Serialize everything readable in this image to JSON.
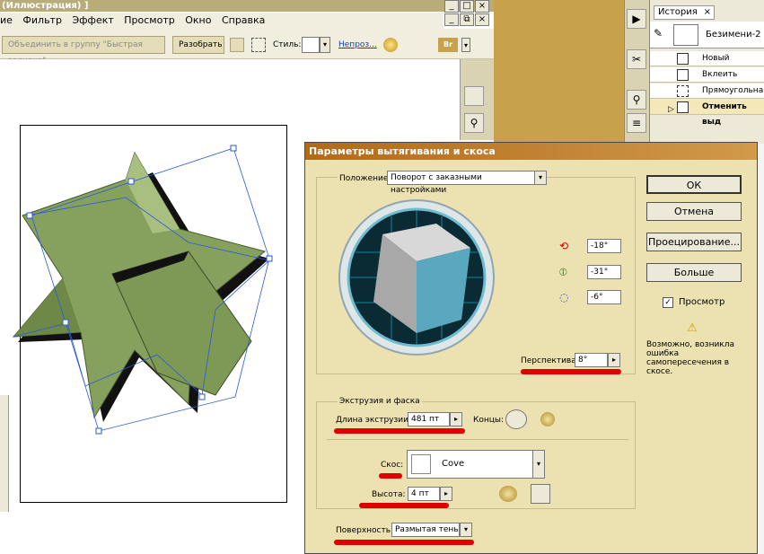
{
  "window": {
    "title": "(Иллюстрация) ]",
    "buttons": [
      "_",
      "□",
      "×"
    ],
    "doc_buttons": [
      "_",
      "⧉",
      "×"
    ]
  },
  "menu": [
    "ие",
    "Фильтр",
    "Эффект",
    "Просмотр",
    "Окно",
    "Справка"
  ],
  "control_bar": {
    "group_button": "Объединить в группу \"Быстрая заливка\"",
    "expand_button": "Разобрать",
    "style_label": "Стиль:",
    "opacity_link": "Непроз...",
    "br_label": "Br"
  },
  "history": {
    "tab_label": "История",
    "tab_close": "×",
    "snapshot_label": "Безимени-2",
    "items": [
      {
        "label": "Новый"
      },
      {
        "label": "Вклеить"
      },
      {
        "label": "Прямоугольная"
      },
      {
        "label": "Отменить выд"
      }
    ]
  },
  "dialog": {
    "title": "Параметры вытягивания и скоса",
    "position_label": "Положение:",
    "position_value": "Поворот с заказными настройками",
    "rot_x": "-18°",
    "rot_y": "-31°",
    "rot_z": "-6°",
    "perspective_label": "Перспектива:",
    "perspective_value": "8°",
    "extrusion_group": "Экструзия и фаска",
    "depth_label": "Длина экструзии:",
    "depth_value": "481 пт",
    "caps_label": "Концы:",
    "bevel_label": "Скос:",
    "bevel_value": "Cove",
    "height_label": "Высота:",
    "height_value": "4 пт",
    "surface_label": "Поверхность:",
    "surface_value": "Размытая тень",
    "ok": "ОК",
    "cancel": "Отмена",
    "map_art": "Проецирование...",
    "more": "Больше",
    "preview_label": "Просмотр",
    "preview_checked": "✓",
    "warning_icon": "⚠",
    "warning_text": "Возможно, возникла ошибка самопересечения в скосе."
  },
  "colors": {
    "title_bar": "#b8ad78",
    "dialog_title": "#b06a1a",
    "dialog_bg": "#ece1b0",
    "star_fill": "#86a05e",
    "annotation_red": "#e00000",
    "cube_left": "#a8a8a8",
    "cube_right": "#5aa8c0"
  }
}
